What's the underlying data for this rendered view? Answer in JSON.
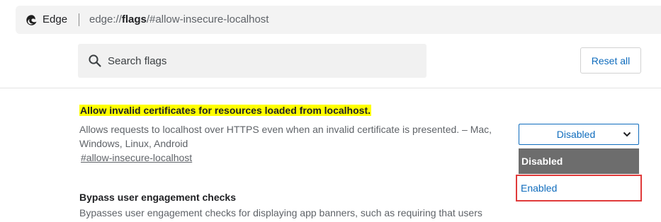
{
  "address_bar": {
    "browser_name": "Edge",
    "url_prefix": "edge://",
    "url_bold": "flags",
    "url_suffix": "/#allow-insecure-localhost"
  },
  "search": {
    "placeholder": "Search flags"
  },
  "reset_button": {
    "label": "Reset all"
  },
  "flags": [
    {
      "title": "Allow invalid certificates for resources loaded from localhost.",
      "description": "Allows requests to localhost over HTTPS even when an invalid certificate is presented. – Mac, Windows, Linux, Android",
      "link": "#allow-insecure-localhost",
      "selected": "Disabled",
      "options": [
        "Disabled",
        "Enabled"
      ]
    },
    {
      "title": "Bypass user engagement checks",
      "description": "Bypasses user engagement checks for displaying app banners, such as requiring that users"
    }
  ],
  "colors": {
    "highlight": "#ffff00",
    "accent": "#0f6cbd",
    "dropdown_selected_bg": "#6d6d6d",
    "annotation_border": "#e03a3a"
  },
  "icons": {
    "logo": "edge-logo",
    "search": "search-icon",
    "dropdown": "chevron-down-icon"
  }
}
